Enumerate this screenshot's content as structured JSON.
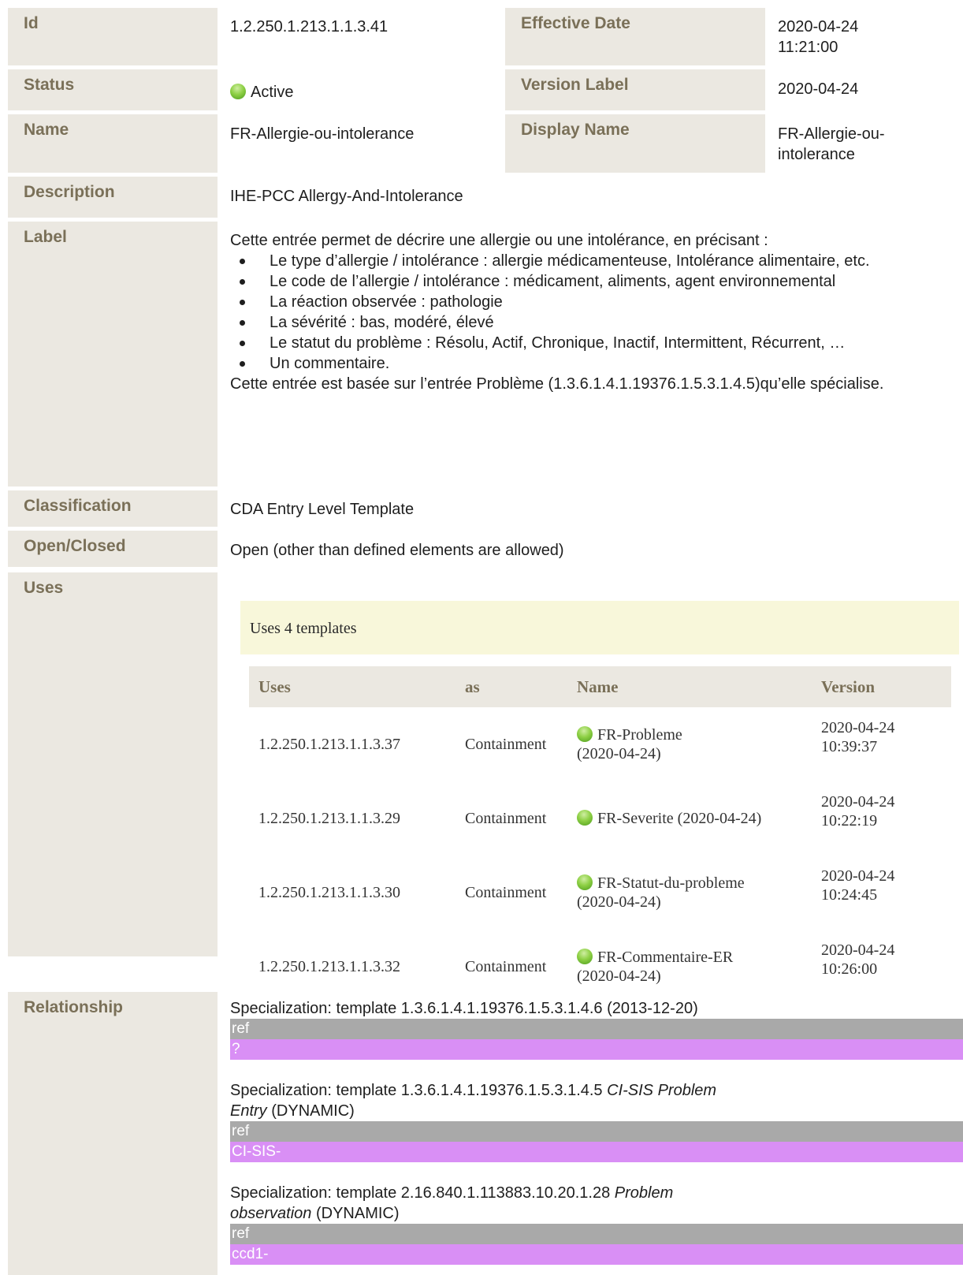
{
  "id": {
    "label": "Id",
    "value": "1.2.250.1.213.1.1.3.41"
  },
  "effective_date": {
    "label": "Effective Date",
    "line1": "2020-04-24",
    "line2": "11:21:00"
  },
  "status": {
    "label": "Status",
    "value": "Active",
    "color": "#8ed045"
  },
  "version_label": {
    "label": "Version Label",
    "value": "2020-04-24"
  },
  "name": {
    "label": "Name",
    "value": "FR-Allergie-ou-intolerance"
  },
  "display_name": {
    "label": "Display Name",
    "line1": "FR-Allergie-ou-",
    "line2": "intolerance"
  },
  "description": {
    "label": "Description",
    "value": "IHE-PCC Allergy-And-Intolerance"
  },
  "label_section": {
    "label": "Label",
    "intro": "Cette entrée permet de décrire une allergie ou une intolérance, en précisant :",
    "items": [
      "Le type d’allergie / intolérance : allergie médicamenteuse, Intolérance alimentaire, etc.",
      "Le code de l’allergie / intolérance : médicament, aliments, agent environnemental",
      "La réaction observée : pathologie",
      "La sévérité : bas, modéré, élevé",
      "Le statut du problème : Résolu, Actif, Chronique, Inactif, Intermittent, Récurrent, …",
      "Un commentaire."
    ],
    "outro": "Cette entrée est basée sur l’entrée Problème (1.3.6.1.4.1.19376.1.5.3.1.4.5)qu’elle spécialise."
  },
  "classification": {
    "label": "Classification",
    "value": "CDA Entry Level Template"
  },
  "open_closed": {
    "label": "Open/Closed",
    "value": "Open (other than defined elements are allowed)"
  },
  "uses": {
    "label": "Uses",
    "summary": "Uses 4 templates",
    "headers": {
      "uses": "Uses",
      "as": "as",
      "name": "Name",
      "version": "Version"
    },
    "rows": [
      {
        "oid": "1.2.250.1.213.1.1.3.37",
        "as": "Containment",
        "name": "FR-Probleme",
        "date": "(2020-04-24)",
        "v1": "2020-04-24",
        "v2": "10:39:37"
      },
      {
        "oid": "1.2.250.1.213.1.1.3.29",
        "as": "Containment",
        "name": "FR-Severite",
        "date": "(2020-04-24)",
        "v1": "2020-04-24",
        "v2": "10:22:19"
      },
      {
        "oid": "1.2.250.1.213.1.1.3.30",
        "as": "Containment",
        "name": "FR-Statut-du-probleme",
        "date": "(2020-04-24)",
        "v1": "2020-04-24",
        "v2": "10:24:45"
      },
      {
        "oid": "1.2.250.1.213.1.1.3.32",
        "as": "Containment",
        "name": "FR-Commentaire-ER",
        "date": "(2020-04-24)",
        "v1": "2020-04-24",
        "v2": "10:26:00"
      }
    ]
  },
  "relationship": {
    "label": "Relationship",
    "specs": [
      {
        "text": "Specialization: template 1.3.6.1.4.1.19376.1.5.3.1.4.6 (2013-12-20)",
        "ref": "ref",
        "prefix": "?"
      },
      {
        "text_a": "Specialization: template 1.3.6.1.4.1.19376.1.5.3.1.4.5 ",
        "italic_a": "CI-SIS Problem",
        "italic_b": "Entry",
        "text_b": " (DYNAMIC)",
        "ref": "ref",
        "prefix": "CI-SIS-"
      },
      {
        "text_a": "Specialization: template 2.16.840.1.113883.10.20.1.28 ",
        "italic_a": "Problem",
        "italic_b": "observation",
        "text_b": " (DYNAMIC)",
        "ref": "ref",
        "prefix": "ccd1-"
      }
    ]
  }
}
